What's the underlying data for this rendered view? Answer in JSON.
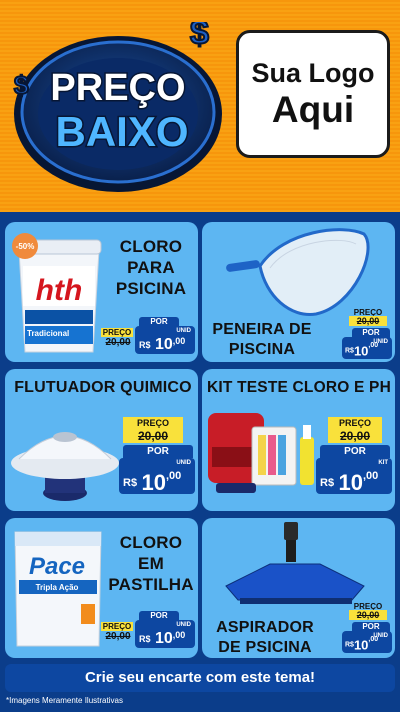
{
  "header": {
    "logo_line1": "Sua Logo",
    "logo_line2": "Aqui",
    "emblem_word1": "PREÇO",
    "emblem_word2": "BAIXO"
  },
  "labels": {
    "preco": "PREÇO",
    "por": "POR",
    "currency": "R$",
    "unid": "UNID",
    "kit": "KIT"
  },
  "products": [
    {
      "title_lines": [
        "CLORO",
        "PARA",
        "PSICINA"
      ],
      "discount": "-50%",
      "brand": "hth",
      "brand_sub": "Tradicional",
      "old": "20,00",
      "int": "10",
      "cents": ",00",
      "unit": "UNID"
    },
    {
      "title_lines": [
        "PENEIRA DE",
        "PISCINA"
      ],
      "old": "20,00",
      "int": "10",
      "cents": ",00",
      "unit": "UNID"
    },
    {
      "title_lines": [
        "FLUTUADOR QUIMICO"
      ],
      "old": "20,00",
      "int": "10",
      "cents": ",00",
      "unit": "UNID"
    },
    {
      "title_lines": [
        "KIT TESTE CLORO E PH"
      ],
      "old": "20,00",
      "int": "10",
      "cents": ",00",
      "unit": "KIT"
    },
    {
      "title_lines": [
        "CLORO",
        "EM",
        "PASTILHA"
      ],
      "brand": "Pace",
      "brand_sub": "Tripla Ação",
      "old": "20,00",
      "int": "10",
      "cents": ",00",
      "unit": "UNID"
    },
    {
      "title_lines": [
        "ASPIRADOR",
        "DE PSICINA"
      ],
      "old": "20,00",
      "int": "10",
      "cents": ",00",
      "unit": "UNID"
    }
  ],
  "cta": "Crie seu encarte com este tema!",
  "footnote": "*Imagens Meramente Ilustrativas",
  "colors": {
    "orange": "#f7960c",
    "sky": "#5db6f2",
    "navy": "#0d47a1",
    "yellow": "#f9e13b"
  }
}
